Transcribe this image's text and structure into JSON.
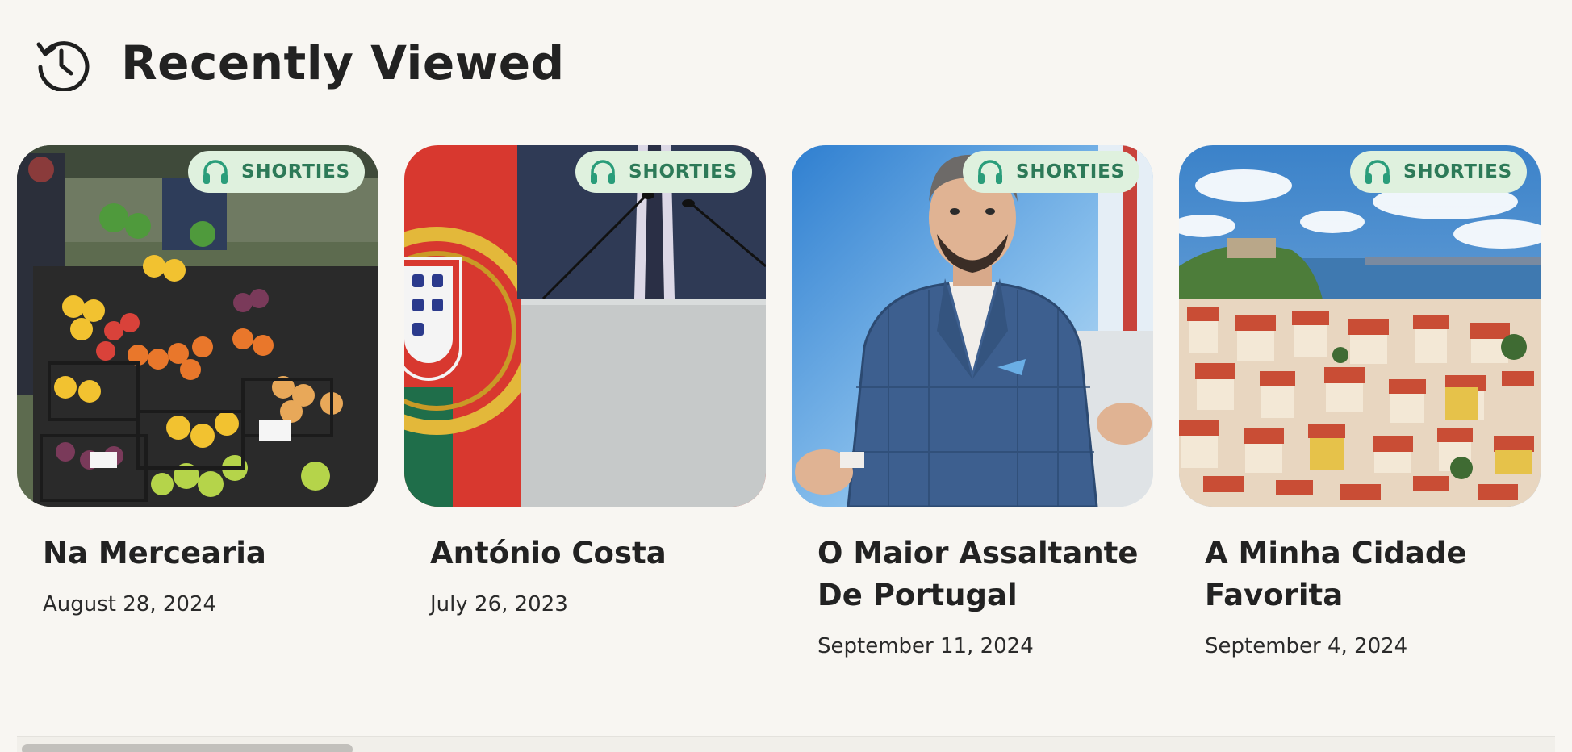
{
  "header": {
    "title": "Recently Viewed",
    "icon": "history-icon"
  },
  "badge_label": "SHORTIES",
  "badge_icon": "headphones-icon",
  "colors": {
    "background": "#f8f6f2",
    "badge_bg": "#dff1de",
    "badge_text": "#2d7a58"
  },
  "cards": [
    {
      "title": "Na Mercearia",
      "date": "August 28, 2024",
      "image": "fruit-market-image"
    },
    {
      "title": "António Costa",
      "date": "July 26, 2023",
      "image": "podium-portugal-flag-image"
    },
    {
      "title": "O Maior Assaltante De Portugal",
      "date": "September 11, 2024",
      "image": "man-in-suit-image"
    },
    {
      "title": "A Minha Cidade Favorita",
      "date": "September 4, 2024",
      "image": "lisbon-city-image"
    }
  ]
}
